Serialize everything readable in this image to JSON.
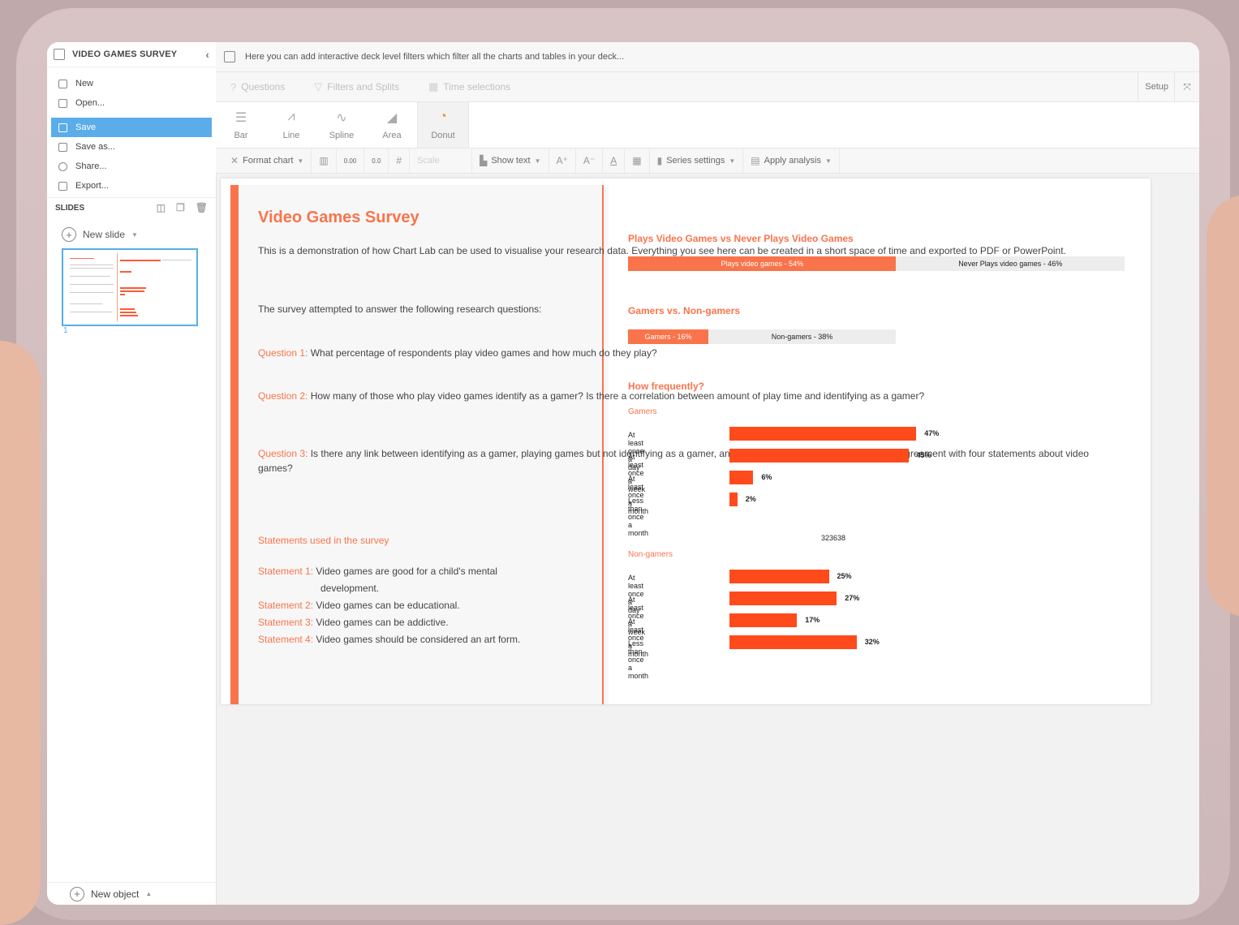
{
  "app": {
    "deck_title": "VIDEO GAMES SURVEY",
    "menu": [
      "New",
      "Open...",
      "Save",
      "Save as...",
      "Share...",
      "Export..."
    ],
    "active_menu": "Save",
    "slides_label": "SLIDES",
    "new_slide_label": "New slide",
    "slide_number": "1",
    "new_object_label": "New object",
    "filter_message": "Here you can add interactive deck level filters which filter all the charts and tables in your deck...",
    "tabs": [
      "Questions",
      "Filters and Splits",
      "Time selections"
    ],
    "setup_label": "Setup",
    "chart_types": [
      "Bar",
      "Line",
      "Spline",
      "Area",
      "Donut"
    ],
    "selected_chart_type": "Donut",
    "format_chart_label": "Format chart",
    "decimal_inc_label": "0.00",
    "decimal_dec_label": "0.0",
    "scale_placeholder": "Scale",
    "show_text_label": "Show text",
    "series_settings_label": "Series settings",
    "apply_analysis_label": "Apply analysis",
    "accent_color": "#f9744b",
    "select_color": "#5aade8",
    "bar_color": "#ff4a1c"
  },
  "slide": {
    "title": "Video Games Survey",
    "intro": "This is a demonstration of how Chart Lab can be used to visualise your research data. Everything you see here can be created in a short space of time and exported to PDF or PowerPoint.",
    "questions_intro": "The survey attempted to answer the following research questions:",
    "questions": [
      {
        "label": "Question 1:",
        "text": " What percentage of respondents play video games and how much do they play?"
      },
      {
        "label": "Question 2:",
        "text": " How many of those who play video games identify as a gamer? Is there a correlation between amount of play time and identifying as a gamer?"
      },
      {
        "label": "Question 3:",
        "text": " Is there any link between identifying as a gamer, playing games but not identifying as a gamer, and never playing games and the level of agreement with four statements about video games?"
      }
    ],
    "statements_heading": "Statements used in the survey",
    "statements": [
      {
        "label": "Statement 1:",
        "text": " Video games are good for a child's mental",
        "text2": "development."
      },
      {
        "label": "Statement 2:",
        "text": " Video games can be educational."
      },
      {
        "label": "Statement 3:",
        "text": "  Video games can be addictive."
      },
      {
        "label": "Statement 4:",
        "text": " Video games should be considered an art form."
      }
    ],
    "stray_text": "323638"
  },
  "chart_data": [
    {
      "type": "bar",
      "title": "Plays Video Games vs Never Plays Video Games",
      "stacked": true,
      "series": [
        {
          "name": "Plays video games - 54%",
          "value": 54,
          "color": "#f9744b"
        },
        {
          "name": "Never Plays video games - 46%",
          "value": 46,
          "color": "#ededed"
        }
      ]
    },
    {
      "type": "bar",
      "title": "Gamers vs. Non-gamers",
      "stacked": true,
      "series": [
        {
          "name": "Gamers - 16%",
          "value": 16,
          "color": "#f9744b"
        },
        {
          "name": "Non-gamers - 38%",
          "value": 38,
          "color": "#ededed"
        }
      ]
    },
    {
      "type": "bar",
      "title": "How frequently?",
      "subtitle": "Gamers",
      "categories": [
        "At least once a day",
        "At least once a week",
        "At least once a month",
        "Less than once a month"
      ],
      "values": [
        47,
        45,
        6,
        2
      ],
      "value_labels": [
        "47%",
        "45%",
        "6%",
        "2%"
      ]
    },
    {
      "type": "bar",
      "subtitle": "Non-gamers",
      "categories": [
        "At least once a day",
        "At least once a week",
        "At least once a month",
        "Less than once a month"
      ],
      "values": [
        25,
        27,
        17,
        32
      ],
      "value_labels": [
        "25%",
        "27%",
        "17%",
        "32%"
      ]
    }
  ]
}
